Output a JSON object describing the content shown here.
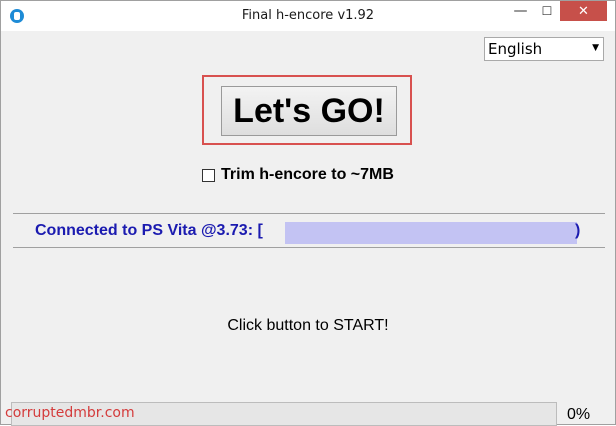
{
  "window": {
    "title": "Final h-encore v1.92",
    "minimize_glyph": "—",
    "maximize_glyph": "☐",
    "close_glyph": "✕"
  },
  "language": {
    "selected": "English",
    "arrow": "▼"
  },
  "main": {
    "go_button_label": "Let's GO!",
    "trim_label": "Trim h-encore to ~7MB",
    "trim_checked": false,
    "connection_prefix": "Connected to PS Vita @3.73: [",
    "connection_suffix": ")",
    "status": "Click button to START!"
  },
  "progress": {
    "percent_text": "0%",
    "value": 0
  },
  "watermark": "corruptedmbr.com",
  "colors": {
    "close_button": "#c7504a",
    "highlight": "#d8514f",
    "connection_text": "#1b1bb0",
    "redaction": "#c3c3f3",
    "watermark": "#d43b3b"
  },
  "icons": {
    "app": "lock-icon",
    "minimize": "minimize-icon",
    "maximize": "maximize-icon",
    "close": "close-icon",
    "dropdown": "chevron-down-icon"
  }
}
